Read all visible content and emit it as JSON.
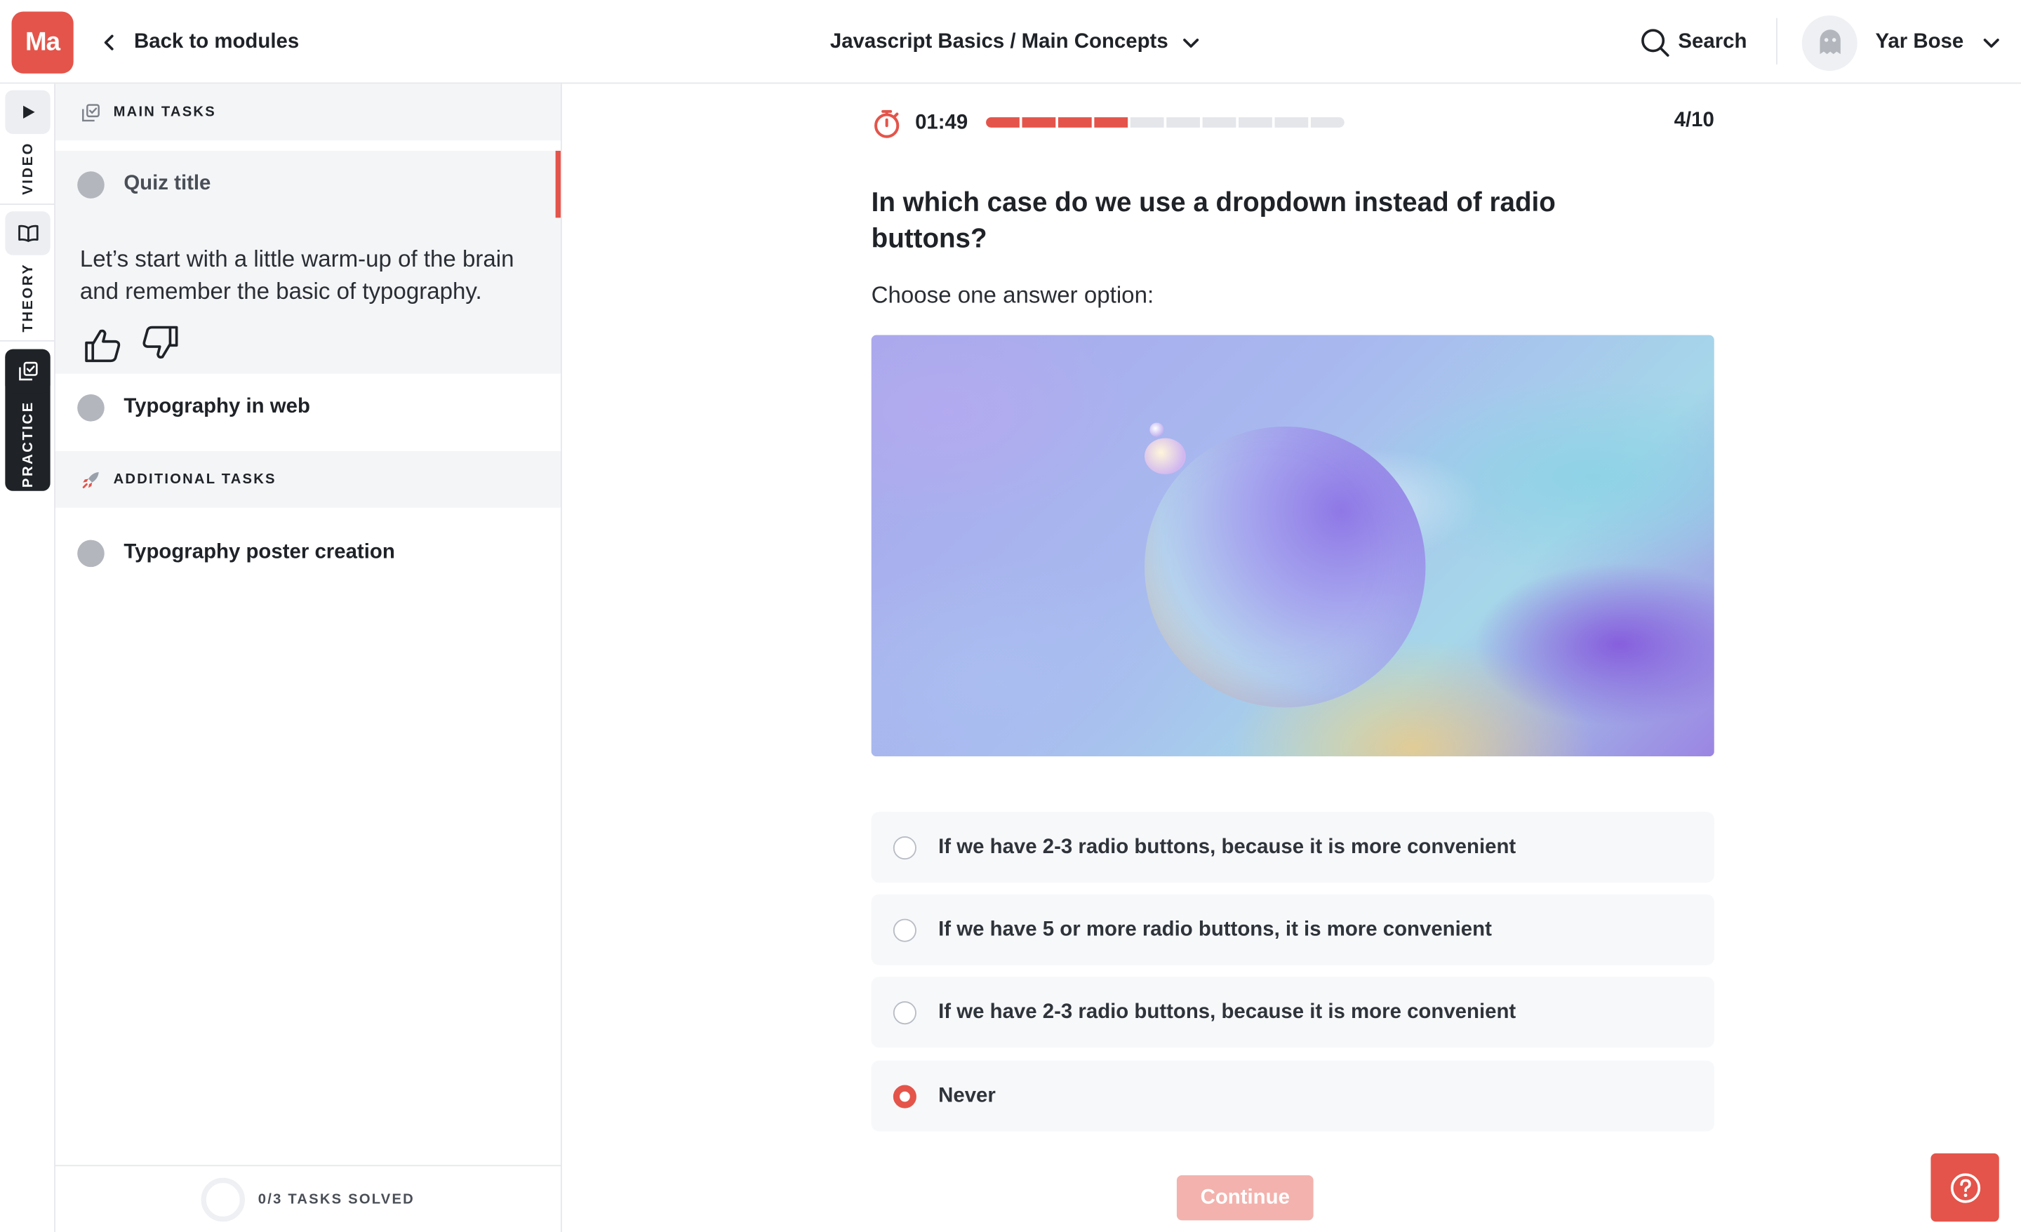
{
  "header": {
    "logo_text": "Ma",
    "back_label": "Back to modules",
    "course_title": "Javascript Basics / Main Concepts",
    "search_label": "Search",
    "user_name": "Yar Bose"
  },
  "rail": {
    "tabs": [
      {
        "label": "VIDEO",
        "icon": "play-icon"
      },
      {
        "label": "THEORY",
        "icon": "book-icon"
      },
      {
        "label": "PRACTICE",
        "icon": "copy-check-icon",
        "active": true
      }
    ]
  },
  "sidebar": {
    "main_tasks_label": "MAIN TASKS",
    "tasks": [
      {
        "title": "Quiz title",
        "active": true,
        "description": "Let’s start with a little warm-up of the brain and remember the basic of typography."
      },
      {
        "title": "Typography in web"
      }
    ],
    "additional_tasks_label": "ADDITIONAL TASKS",
    "additional_tasks": [
      {
        "title": "Typography poster creation"
      }
    ],
    "footer_label": "0/3 TASKS SOLVED"
  },
  "quiz": {
    "timer": "01:49",
    "progress": {
      "answered": 4,
      "total": 10
    },
    "counter": "4/10",
    "question": "In which case do we use a dropdown instead of radio buttons?",
    "instruction": "Choose one answer option:",
    "options": [
      {
        "label": "If we have 2-3 radio buttons, because it is more convenient",
        "selected": false
      },
      {
        "label": "If we have 5 or more radio buttons, it is more convenient",
        "selected": false
      },
      {
        "label": "If we have 2-3 radio buttons, because it is more convenient",
        "selected": false
      },
      {
        "label": "Never",
        "selected": true
      }
    ],
    "continue_label": "Continue"
  },
  "colors": {
    "accent": "#e4544a",
    "accent_disabled": "#f3b2ad",
    "panel_bg": "#f4f5f7",
    "text": "#1f2328"
  }
}
